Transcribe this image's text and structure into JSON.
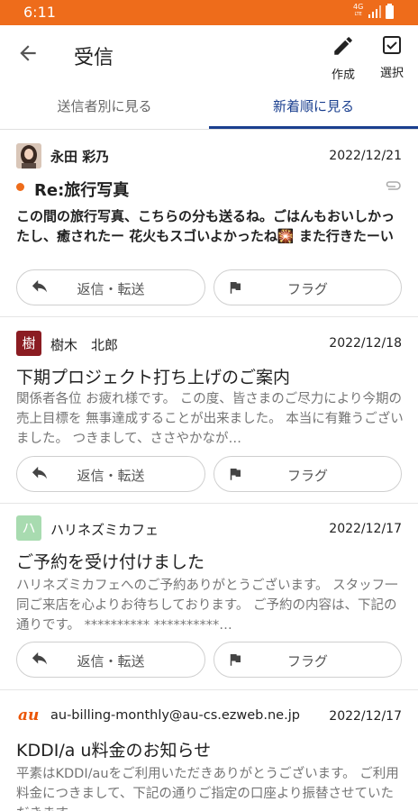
{
  "status_bar": {
    "time": "6:11",
    "network": "4G",
    "network_sub": "LTE"
  },
  "app_bar": {
    "title": "受信",
    "compose_label": "作成",
    "select_label": "選択"
  },
  "tabs": [
    {
      "label": "送信者別に見る"
    },
    {
      "label": "新着順に見る"
    }
  ],
  "mails": [
    {
      "sender": "永田 彩乃",
      "date": "2022/12/21",
      "subject": "Re:旅行写真",
      "preview": "この間の旅行写真、こちらの分も送るね。ごはんもおいしかったし、癒されたー 花火もスゴいよかったね🎇 また行きたーい",
      "reply_label": "返信・転送",
      "flag_label": "フラグ"
    },
    {
      "avatar_text": "樹",
      "sender": "樹木　北郎",
      "date": "2022/12/18",
      "subject": "下期プロジェクト打ち上げのご案内",
      "preview": "関係者各位 お疲れ様です。 この度、皆さまのご尽力により今期の売上目標を 無事達成することが出来ました。 本当に有難うございました。 つきまして、ささやかなが…",
      "reply_label": "返信・転送",
      "flag_label": "フラグ"
    },
    {
      "avatar_text": "ハ",
      "sender": "ハリネズミカフェ",
      "date": "2022/12/17",
      "subject": "ご予約を受け付けました",
      "preview": "ハリネズミカフェへのご予約ありがとうございます。 スタッフ一同ご来店を心よりお待ちしております。 ご予約の内容は、下記の通りです。 ********** **********…",
      "reply_label": "返信・転送",
      "flag_label": "フラグ"
    },
    {
      "avatar_text": "au",
      "sender": "au-billing-monthly@au-cs.ezweb.ne.jp",
      "date": "2022/12/17",
      "subject": "KDDI/a u料金のお知らせ",
      "preview": "平素はKDDI/auをご利用いただきありがとうございます。 ご利用料金につきまして、下記の通りご指定の口座より振替させていただきます。"
    }
  ],
  "colors": {
    "accent": "#ee6c1b",
    "tab_active": "#1a3f8f",
    "avatar_2": "#8b1c22",
    "avatar_3": "#a8dbb0",
    "au_logo": "#eb5505"
  },
  "icons": [
    "back-arrow-icon",
    "pencil-icon",
    "checkbox-icon",
    "reply-icon",
    "flag-icon",
    "attachment-icon"
  ]
}
